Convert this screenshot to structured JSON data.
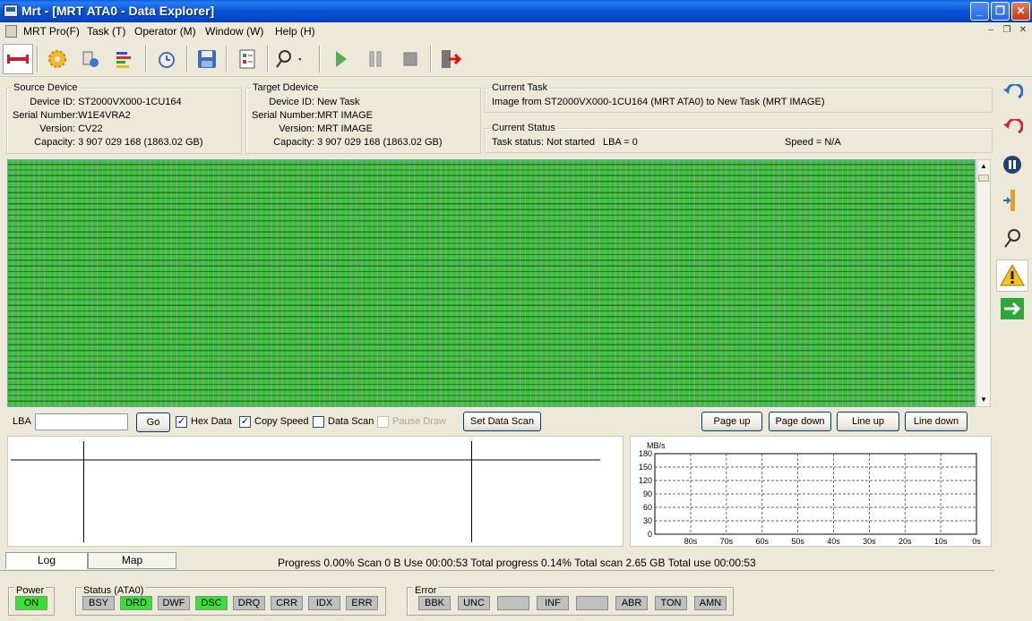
{
  "window": {
    "title": "Mrt - [MRT ATA0 - Data Explorer]",
    "buttons": [
      "_",
      "❐",
      "✕"
    ]
  },
  "menu": {
    "items": [
      "MRT Pro(F)",
      "Task (T)",
      "Operator (M)",
      "Window (W)",
      "Help (H)"
    ],
    "mdi": [
      "–",
      "❐",
      "✕"
    ]
  },
  "toolbar": {
    "icons": [
      "connect-icon",
      "settings-gear-icon",
      "drive-icon",
      "color-bars-icon",
      "timer-icon",
      "save-icon",
      "task-list-icon",
      "tools-icon",
      "play-icon",
      "pause-icon",
      "stop-icon",
      "exit-icon"
    ],
    "colors": {
      "play": "#4caf50",
      "exit_arrow": "#d11",
      "connect": "#d3182b"
    }
  },
  "source": {
    "legend": "Source Device",
    "device_id_label": "Device ID:",
    "device_id": "ST2000VX000-1CU164",
    "serial_label": "Serial Number:",
    "serial": "W1E4VRA2",
    "version_label": "Version:",
    "version": "CV22",
    "capacity_label": "Capacity:",
    "capacity": "3 907 029 168 (1863.02 GB)"
  },
  "target": {
    "legend": "Target Ddevice",
    "device_id_label": "Device ID:",
    "device_id": "New Task",
    "serial_label": "Serial Number:",
    "serial": "MRT IMAGE",
    "version_label": "Version:",
    "version": "MRT IMAGE",
    "capacity_label": "Capacity:",
    "capacity": "3 907 029 168 (1863.02 GB)"
  },
  "current_task": {
    "legend": "Current Task",
    "text": "Image from ST2000VX000-1CU164 (MRT ATA0) to New Task (MRT IMAGE)"
  },
  "current_status": {
    "legend": "Current Status",
    "task_status": "Task status: Not started",
    "lba": "LBA = 0",
    "speed": "Speed = N/A"
  },
  "sector_map": {
    "cell_color": "#33d433",
    "gap_color": "#9a9a9a"
  },
  "controls": {
    "lba_label": "LBA",
    "lba_value": "",
    "go": "Go",
    "hex_data": "Hex Data",
    "hex_data_checked": true,
    "copy_speed": "Copy Speed",
    "copy_speed_checked": true,
    "data_scan": "Data Scan",
    "data_scan_checked": false,
    "pause_draw": "Pause Draw",
    "pause_draw_checked": false,
    "set_data_scan": "Set Data Scan",
    "page_up": "Page up",
    "page_down": "Page down",
    "line_up": "Line up",
    "line_down": "Line down"
  },
  "chart_data": {
    "type": "line",
    "ylabel": "MB/s",
    "yticks": [
      "180",
      "150",
      "120",
      "90",
      "60",
      "30",
      "0"
    ],
    "xticks": [
      "80s",
      "70s",
      "60s",
      "50s",
      "40s",
      "30s",
      "20s",
      "10s",
      "0s"
    ],
    "ylim": [
      0,
      180
    ],
    "grid": true,
    "series": []
  },
  "tabs": {
    "log": "Log",
    "map": "Map"
  },
  "progress": {
    "text": "Progress 0.00% Scan 0 B Use 00:00:53   Total progress 0.14% Total scan 2.65 GB Total use 00:00:53"
  },
  "right_toolbar": {
    "icons": [
      "undo-icon",
      "redo-icon",
      "pause-circle-icon",
      "ruler-icon",
      "wrench-icon",
      "warning-icon",
      "next-arrow-icon"
    ]
  },
  "status_bar": {
    "power_title": "Power",
    "power_value": "ON",
    "status_title": "Status (ATA0)",
    "status_flags": [
      {
        "label": "BSY",
        "on": false
      },
      {
        "label": "DRD",
        "on": true
      },
      {
        "label": "DWF",
        "on": false
      },
      {
        "label": "DSC",
        "on": true
      },
      {
        "label": "DRQ",
        "on": false
      },
      {
        "label": "CRR",
        "on": false
      },
      {
        "label": "IDX",
        "on": false
      },
      {
        "label": "ERR",
        "on": false
      }
    ],
    "error_title": "Error",
    "error_flags": [
      {
        "label": "BBK"
      },
      {
        "label": "UNC"
      },
      {
        "label": ""
      },
      {
        "label": "INF"
      },
      {
        "label": ""
      },
      {
        "label": "ABR"
      },
      {
        "label": "TON"
      },
      {
        "label": "AMN"
      }
    ]
  }
}
